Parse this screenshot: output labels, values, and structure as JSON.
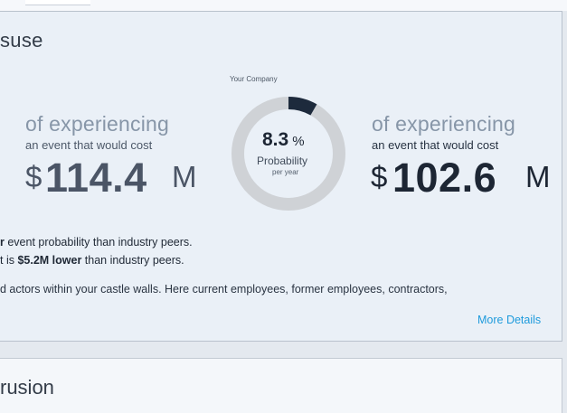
{
  "card1": {
    "title": "suse",
    "left": {
      "of_experiencing": "of experiencing",
      "sub": "an event that would cost",
      "currency": "$",
      "amount": "114.4",
      "unit": "M"
    },
    "center": {
      "label": "Your Company",
      "percent": "8.3",
      "percent_sign": "%",
      "caption": "Probability",
      "subcaption": "per year",
      "probability_fraction": 0.083,
      "ring_color": "#cfd2d6",
      "fill_color": "#1d2a3c"
    },
    "right": {
      "of_experiencing": "of experiencing",
      "sub": "an event that would cost",
      "currency": "$",
      "amount": "102.6",
      "unit": "M"
    },
    "line1": {
      "bold": "r",
      "text": " event probability than industry peers."
    },
    "line2": {
      "prefix": "t is ",
      "bold": "$5.2M lower",
      "suffix": " than industry peers."
    },
    "line3": "d actors within your castle walls. Here current employees, former employees, contractors,",
    "more_details": "More Details"
  },
  "card2": {
    "title": "rusion"
  },
  "colors": {
    "left_amount": "#4b5566",
    "right_amount": "#1d2634",
    "link": "#1f9bdc"
  }
}
